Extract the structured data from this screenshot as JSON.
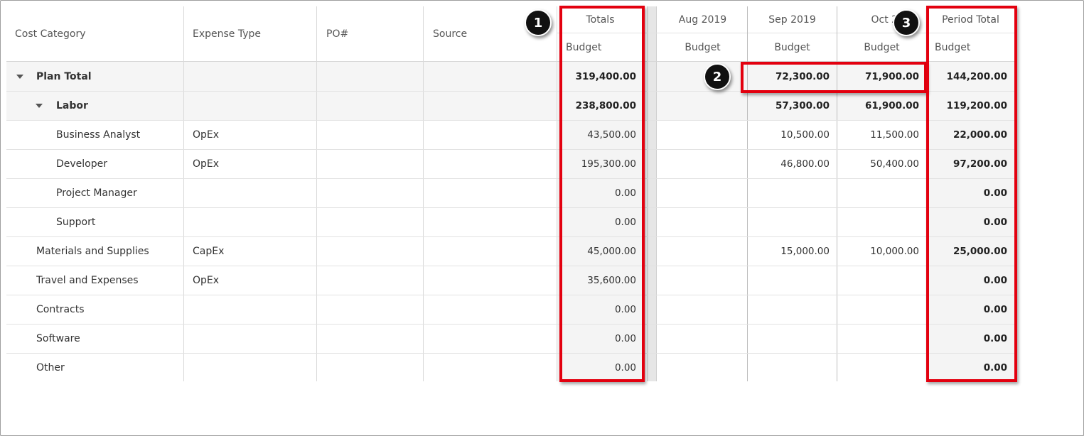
{
  "columns": {
    "cost_category": "Cost Category",
    "expense_type": "Expense Type",
    "po": "PO#",
    "source": "Source",
    "totals": "Totals",
    "aug": "Aug 2019",
    "sep": "Sep 2019",
    "oct": "Oct 20",
    "period_total": "Period Total",
    "budget": "Budget"
  },
  "rows": [
    {
      "category": "Plan Total",
      "expense": "",
      "totals": "319,400.00",
      "aug": "",
      "sep": "72,300.00",
      "oct": "71,900.00",
      "period": "144,200.00"
    },
    {
      "category": "Labor",
      "expense": "",
      "totals": "238,800.00",
      "aug": "",
      "sep": "57,300.00",
      "oct": "61,900.00",
      "period": "119,200.00"
    },
    {
      "category": "Business Analyst",
      "expense": "OpEx",
      "totals": "43,500.00",
      "aug": "",
      "sep": "10,500.00",
      "oct": "11,500.00",
      "period": "22,000.00"
    },
    {
      "category": "Developer",
      "expense": "OpEx",
      "totals": "195,300.00",
      "aug": "",
      "sep": "46,800.00",
      "oct": "50,400.00",
      "period": "97,200.00"
    },
    {
      "category": "Project Manager",
      "expense": "",
      "totals": "0.00",
      "aug": "",
      "sep": "",
      "oct": "",
      "period": "0.00"
    },
    {
      "category": "Support",
      "expense": "",
      "totals": "0.00",
      "aug": "",
      "sep": "",
      "oct": "",
      "period": "0.00"
    },
    {
      "category": "Materials and Supplies",
      "expense": "CapEx",
      "totals": "45,000.00",
      "aug": "",
      "sep": "15,000.00",
      "oct": "10,000.00",
      "period": "25,000.00"
    },
    {
      "category": "Travel and Expenses",
      "expense": "OpEx",
      "totals": "35,600.00",
      "aug": "",
      "sep": "",
      "oct": "",
      "period": "0.00"
    },
    {
      "category": "Contracts",
      "expense": "",
      "totals": "0.00",
      "aug": "",
      "sep": "",
      "oct": "",
      "period": "0.00"
    },
    {
      "category": "Software",
      "expense": "",
      "totals": "0.00",
      "aug": "",
      "sep": "",
      "oct": "",
      "period": "0.00"
    },
    {
      "category": "Other",
      "expense": "",
      "totals": "0.00",
      "aug": "",
      "sep": "",
      "oct": "",
      "period": "0.00"
    }
  ],
  "annotations": {
    "badge_1": "1",
    "badge_2": "2",
    "badge_3": "3",
    "highlight_color": "#e3000f"
  }
}
